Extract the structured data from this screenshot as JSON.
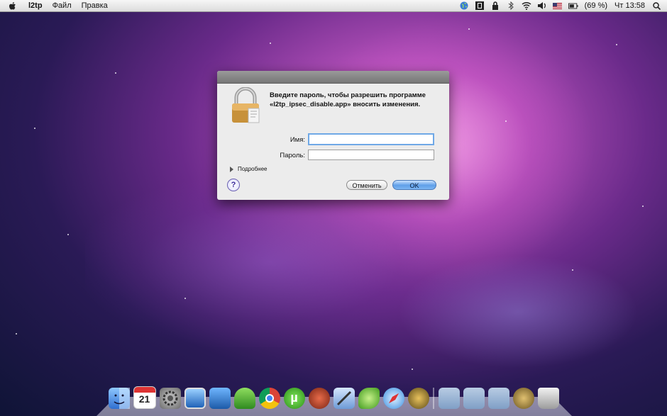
{
  "menubar": {
    "app_name": "l2tp",
    "items": [
      "Файл",
      "Правка"
    ],
    "battery": "(69 %)",
    "clock": "Чт 13:58",
    "icons": [
      "apple-icon",
      "globe-icon",
      "vpn-icon",
      "lock-icon",
      "bluetooth-icon",
      "wifi-icon",
      "volume-icon",
      "flag-us-icon",
      "battery-icon",
      "search-icon"
    ]
  },
  "dialog": {
    "message": "Введите пароль, чтобы разрешить программе «l2tp_ipsec_disable.app» вносить изменения.",
    "name_label": "Имя:",
    "name_value": "",
    "password_label": "Пароль:",
    "password_value": "",
    "details_label": "Подробнее",
    "help_label": "?",
    "cancel_label": "Отменить",
    "ok_label": "OK"
  },
  "dock": {
    "calendar_day": "21",
    "icons": [
      "finder-icon",
      "calendar-icon",
      "system-preferences-icon",
      "preview-icon",
      "automator-icon",
      "adium-icon",
      "chrome-icon",
      "utorrent-icon",
      "caramba-icon",
      "xcode-icon",
      "leaf-icon",
      "safari-icon",
      "compass-icon",
      "applications-folder-icon",
      "documents-folder-icon",
      "downloads-folder-icon",
      "time-machine-icon",
      "trash-icon"
    ]
  },
  "colors": {
    "ok_button": "#5f9fe8",
    "titlebar": "#868686",
    "help_icon": "#3b2a9a"
  }
}
